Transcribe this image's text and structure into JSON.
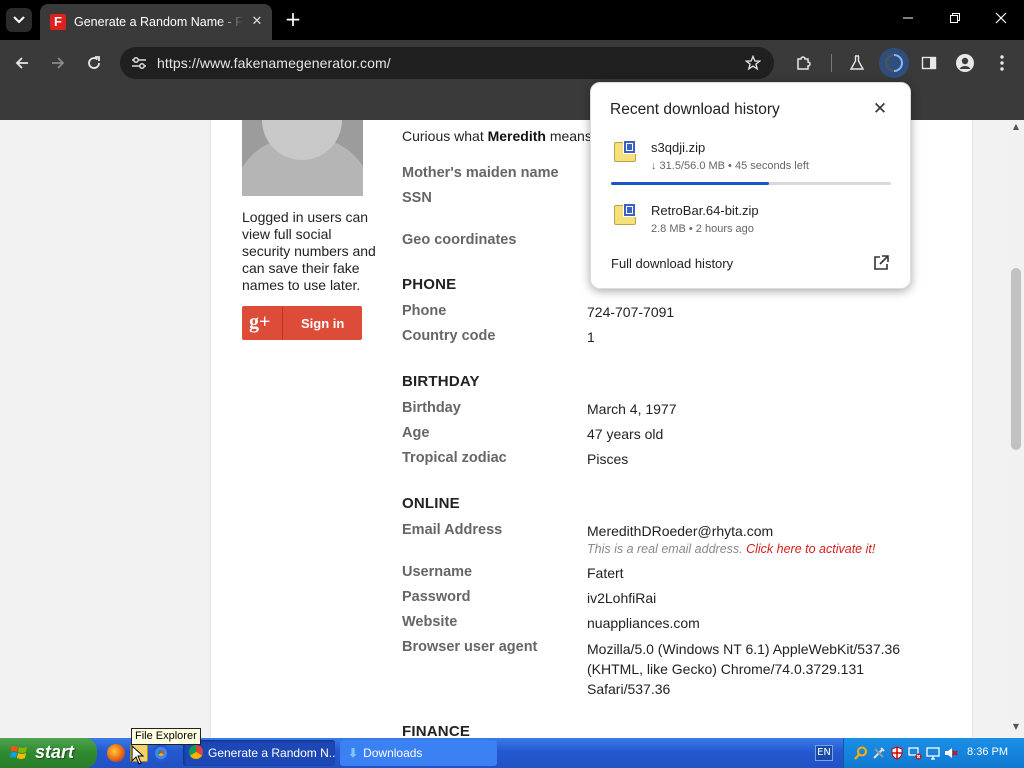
{
  "browser": {
    "tab_title": "Generate a Random Name - Fake Name Generator",
    "favicon_letter": "F",
    "new_tab": "+",
    "url": "https://www.fakenamegenerator.com/"
  },
  "sidebar": {
    "login_note": "Logged in users can view full social security numbers and can save their fake names to use later.",
    "signin_icon": "g+",
    "signin_label": "Sign in"
  },
  "identity": {
    "curious_prefix": "Curious what ",
    "curious_name": "Meredith",
    "curious_suffix": " means?",
    "rows": [
      {
        "label": "Mother's maiden name",
        "value": ""
      },
      {
        "label": "SSN",
        "value": ""
      },
      {
        "label": "Geo coordinates",
        "value": ""
      }
    ]
  },
  "phone": {
    "heading": "PHONE",
    "rows": [
      {
        "label": "Phone",
        "value": "724-707-7091"
      },
      {
        "label": "Country code",
        "value": "1"
      }
    ]
  },
  "birthday": {
    "heading": "BIRTHDAY",
    "rows": [
      {
        "label": "Birthday",
        "value": "March 4, 1977"
      },
      {
        "label": "Age",
        "value": "47 years old"
      },
      {
        "label": "Tropical zodiac",
        "value": "Pisces"
      }
    ]
  },
  "online": {
    "heading": "ONLINE",
    "email_label": "Email Address",
    "email_value": "MeredithDRoeder@rhyta.com",
    "email_note": "This is a real email address. ",
    "email_activate": "Click here to activate it!",
    "rows": [
      {
        "label": "Username",
        "value": "Fatert"
      },
      {
        "label": "Password",
        "value": "iv2LohfiRai"
      },
      {
        "label": "Website",
        "value": "nuappliances.com"
      }
    ],
    "ua_label": "Browser user agent",
    "ua_value": "Mozilla/5.0 (Windows NT 6.1) AppleWebKit/537.36 (KHTML, like Gecko) Chrome/74.0.3729.131 Safari/537.36"
  },
  "finance": {
    "heading": "FINANCE"
  },
  "downloads": {
    "title": "Recent download history",
    "items": [
      {
        "name": "s3qdji.zip",
        "status": "↓ 31.5/56.0 MB • 45 seconds left",
        "progress": 0.5625
      },
      {
        "name": "RetroBar.64-bit.zip",
        "status": "2.8 MB • 2 hours ago"
      }
    ],
    "full_history": "Full download history"
  },
  "taskbar": {
    "start_label": "start",
    "tasks": [
      {
        "label": "Generate a Random N..."
      },
      {
        "label": "Downloads"
      }
    ],
    "language": "EN",
    "clock": "8:36 PM",
    "tooltip": "File Explorer"
  },
  "colors": {
    "accent_blue": "#1a56c8",
    "gplus_red": "#dd4b39",
    "activate_red": "#d61e1e",
    "taskbar_blue": "#2458cf",
    "start_green": "#2f8a2f"
  }
}
